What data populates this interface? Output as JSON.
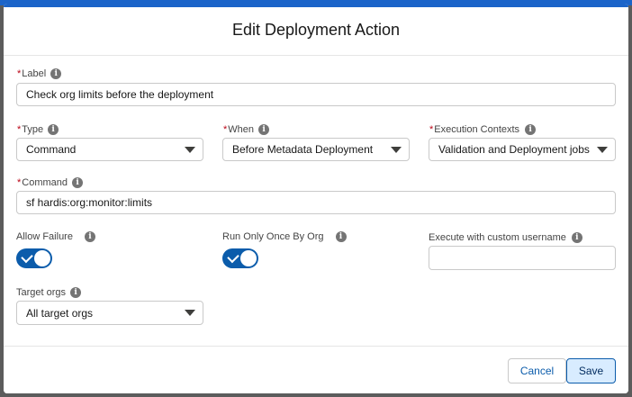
{
  "modal": {
    "title": "Edit Deployment Action"
  },
  "form": {
    "label": {
      "caption": "Label",
      "value": "Check org limits before the deployment"
    },
    "type": {
      "caption": "Type",
      "value": "Command"
    },
    "when": {
      "caption": "When",
      "value": "Before Metadata Deployment"
    },
    "execution_contexts": {
      "caption": "Execution Contexts",
      "value": "Validation and Deployment jobs"
    },
    "command": {
      "caption": "Command",
      "value": "sf hardis:org:monitor:limits"
    },
    "allow_failure": {
      "caption": "Allow Failure",
      "checked": true
    },
    "run_only_once": {
      "caption": "Run Only Once By Org",
      "checked": true
    },
    "custom_username": {
      "caption": "Execute with custom username",
      "value": ""
    },
    "target_orgs": {
      "caption": "Target orgs",
      "value": "All target orgs"
    },
    "required_marker": "*",
    "info_glyph": "i"
  },
  "footer": {
    "cancel_label": "Cancel",
    "save_label": "Save"
  },
  "colors": {
    "brand": "#0b5cab",
    "required": "#ba0517",
    "save_bg": "#d8ecff"
  }
}
